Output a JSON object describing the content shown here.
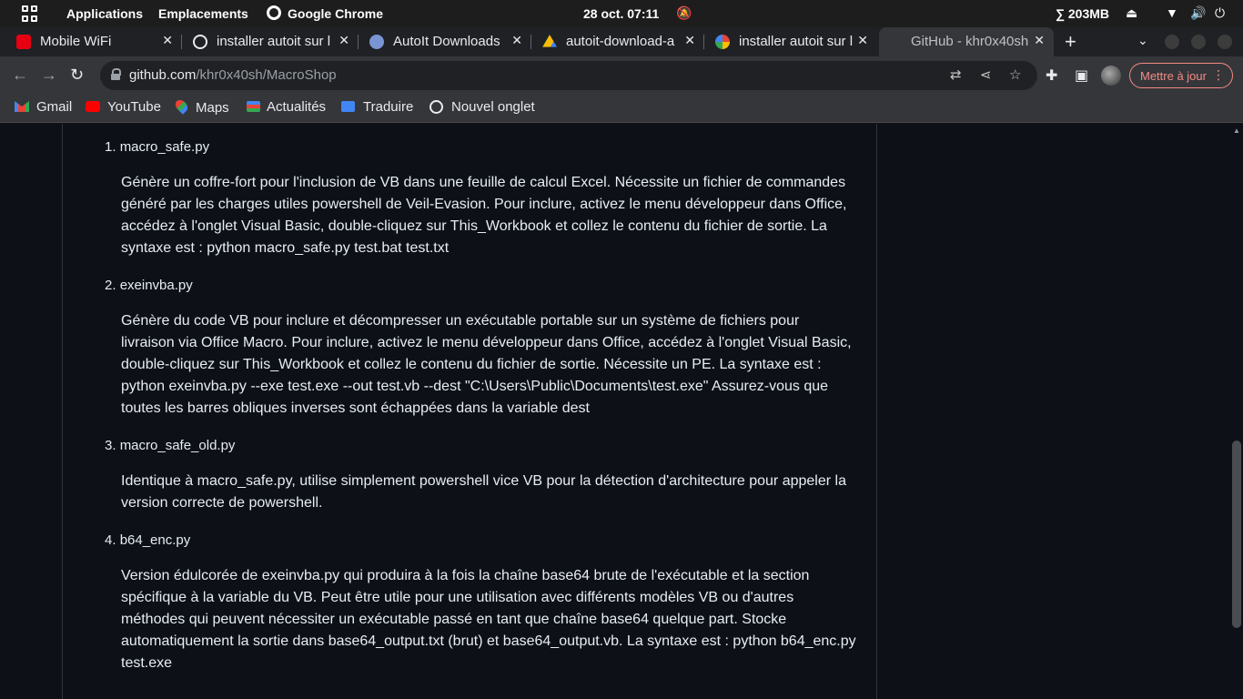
{
  "topbar": {
    "applications": "Applications",
    "places": "Emplacements",
    "app_name": "Google Chrome",
    "datetime": "28 oct.  07:11",
    "memory": "∑ 203MB"
  },
  "tabs": [
    {
      "title": "Mobile WiFi",
      "favicon_color": "#e60012"
    },
    {
      "title": "installer autoit sur l",
      "favicon_color": "#e8eaed"
    },
    {
      "title": "AutoIt Downloads",
      "favicon_color": "#7a95d4"
    },
    {
      "title": "autoit-download-a",
      "favicon_color": "#34a853"
    },
    {
      "title": "installer autoit sur l",
      "favicon_color": "#ffffff"
    },
    {
      "title": "GitHub - khr0x40sh",
      "favicon_color": "#35363a"
    }
  ],
  "toolbar": {
    "url_host": "github.com",
    "url_path": "/khr0x40sh/MacroShop",
    "update_label": "Mettre à jour"
  },
  "bookmarks": [
    {
      "label": "Gmail",
      "icon": "gmail-icon"
    },
    {
      "label": "YouTube",
      "icon": "youtube-icon"
    },
    {
      "label": "Maps",
      "icon": "maps-icon"
    },
    {
      "label": "Actualités",
      "icon": "news-icon"
    },
    {
      "label": "Traduire",
      "icon": "translate-icon"
    },
    {
      "label": "Nouvel onglet",
      "icon": "globe-icon"
    }
  ],
  "article": {
    "items": [
      {
        "num": "1.",
        "title": "macro_safe.py",
        "desc": "Génère un coffre-fort pour l'inclusion de VB dans une feuille de calcul Excel. Nécessite un fichier de commandes généré par les charges utiles powershell de Veil-Evasion. Pour inclure, activez le menu développeur dans Office, accédez à l'onglet Visual Basic, double-cliquez sur This_Workbook et collez le contenu du fichier de sortie. La syntaxe est : python macro_safe.py test.bat test.txt"
      },
      {
        "num": "2.",
        "title": "exeinvba.py",
        "desc": "Génère du code VB pour inclure et décompresser un exécutable portable sur un système de fichiers pour livraison via Office Macro. Pour inclure, activez le menu développeur dans Office, accédez à l'onglet Visual Basic, double-cliquez sur This_Workbook et collez le contenu du fichier de sortie. Nécessite un PE. La syntaxe est : python exeinvba.py --exe test.exe --out test.vb --dest \"C:\\Users\\Public\\Documents\\test.exe\" Assurez-vous que toutes les barres obliques inverses sont échappées dans la variable dest"
      },
      {
        "num": "3.",
        "title": "macro_safe_old.py",
        "desc": "Identique à macro_safe.py, utilise simplement powershell vice VB pour la détection d'architecture pour appeler la version correcte de powershell."
      },
      {
        "num": "4.",
        "title": "b64_enc.py",
        "desc": "Version édulcorée de exeinvba.py qui produira à la fois la chaîne base64 brute de l'exécutable et la section spécifique à la variable du VB. Peut être utile pour une utilisation avec différents modèles VB ou d'autres méthodes qui peuvent nécessiter un exécutable passé en tant que chaîne base64 quelque part. Stocke automatiquement la sortie dans base64_output.txt (brut) et base64_output.vb. La syntaxe est : python b64_enc.py test.exe"
      }
    ]
  }
}
